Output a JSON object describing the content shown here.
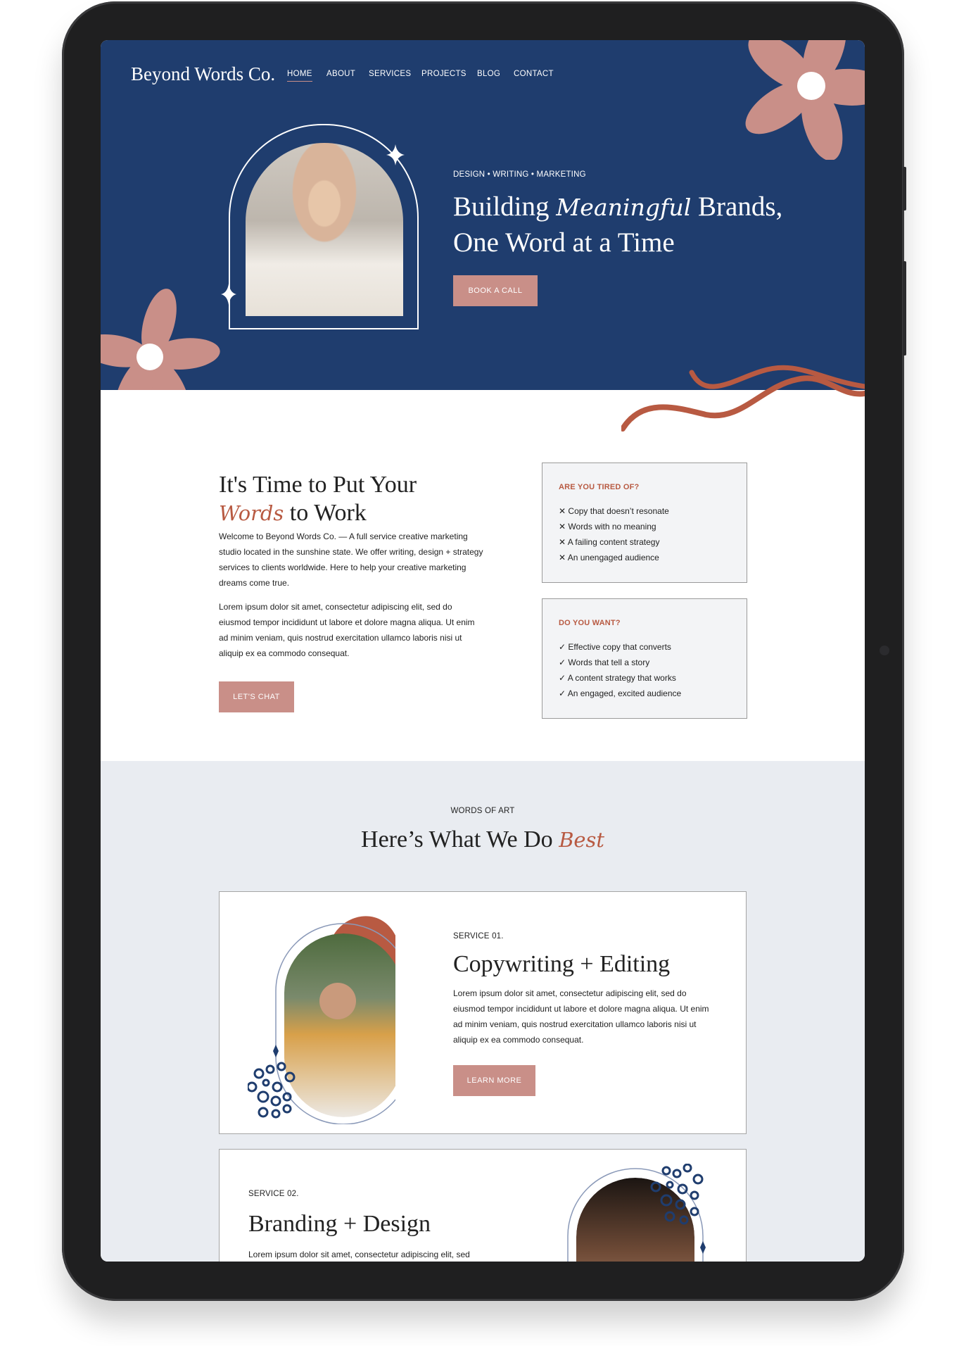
{
  "colors": {
    "navy": "#1f3d6e",
    "terracotta": "#b85a42",
    "blush": "#c98f88",
    "light_bg": "#e9ecf1",
    "box_bg": "#f3f4f6"
  },
  "header": {
    "logo": "Beyond Words Co.",
    "nav": [
      {
        "label": "HOME",
        "active": true
      },
      {
        "label": "ABOUT"
      },
      {
        "label": "SERVICES"
      },
      {
        "label": "PROJECTS"
      },
      {
        "label": "BLOG"
      },
      {
        "label": "CONTACT"
      }
    ]
  },
  "hero": {
    "tagline": "DESIGN • WRITING • MARKETING",
    "headline_pre": "Building ",
    "headline_script": "Meaningful",
    "headline_post": " Brands,",
    "headline_line2": "One Word at a Time",
    "cta": "BOOK A CALL",
    "photo_icon": "portrait-woman-hat"
  },
  "intro": {
    "heading_line1": "It's Time to Put Your",
    "heading_script": "Words",
    "heading_line2_post": " to Work",
    "paragraph1": "Welcome to Beyond Words Co. — A full service creative marketing studio located in the sunshine state. We offer writing, design + strategy services to clients worldwide. Here to help your creative marketing dreams come true.",
    "paragraph2": "Lorem ipsum dolor sit amet, consectetur adipiscing elit, sed do eiusmod tempor incididunt ut labore et dolore magna aliqua. Ut enim ad minim veniam, quis nostrud exercitation ullamco laboris nisi ut aliquip ex ea commodo consequat.",
    "cta": "LET'S CHAT",
    "tired": {
      "title": "ARE YOU TIRED OF?",
      "icon": "x-icon",
      "mark": "✕",
      "items": [
        "Copy that doesn’t resonate",
        "Words with no meaning",
        "A failing content strategy",
        "An unengaged audience"
      ]
    },
    "want": {
      "title": "DO YOU WANT?",
      "icon": "check-icon",
      "mark": "✓",
      "items": [
        "Effective copy that converts",
        "Words that tell a story",
        "A content strategy that works",
        "An engaged, excited audience"
      ]
    }
  },
  "services": {
    "eyebrow": "WORDS OF ART",
    "heading_pre": "Here’s What We Do ",
    "heading_script": "Best",
    "items": [
      {
        "label": "SERVICE 01.",
        "title": "Copywriting + Editing",
        "text": "Lorem ipsum dolor sit amet, consectetur adipiscing elit, sed do eiusmod tempor incididunt ut labore et dolore magna aliqua. Ut enim ad minim veniam, quis nostrud exercitation ullamco laboris nisi ut aliquip ex ea commodo consequat.",
        "cta": "LEARN MORE"
      },
      {
        "label": "SERVICE 02.",
        "title": "Branding + Design",
        "text": "Lorem ipsum dolor sit amet, consectetur adipiscing elit, sed"
      }
    ]
  }
}
